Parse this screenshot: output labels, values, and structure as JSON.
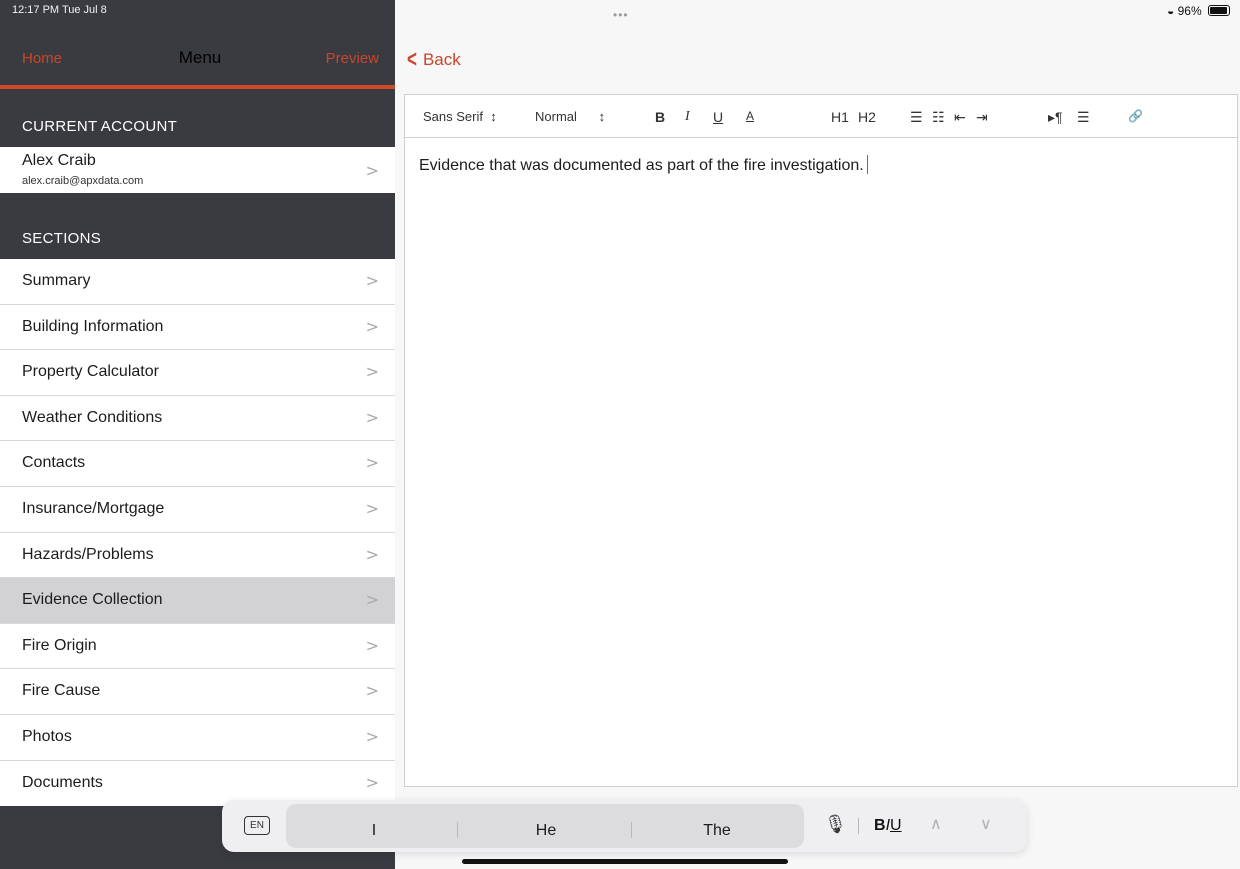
{
  "status_bar": {
    "time": "12:17 PM  Tue Jul 8",
    "dots": "•••",
    "battery": "96%"
  },
  "sidebar": {
    "nav": {
      "home": "Home",
      "title": "Menu",
      "preview": "Preview"
    },
    "account_header": "CURRENT ACCOUNT",
    "account": {
      "name": "Alex Craib",
      "email": "alex.craib@apxdata.com"
    },
    "sections_header": "SECTIONS",
    "items": [
      {
        "label": "Summary"
      },
      {
        "label": "Building Information"
      },
      {
        "label": "Property Calculator"
      },
      {
        "label": "Weather Conditions"
      },
      {
        "label": "Contacts"
      },
      {
        "label": "Insurance/Mortgage"
      },
      {
        "label": "Hazards/Problems"
      },
      {
        "label": "Evidence Collection",
        "selected": true
      },
      {
        "label": "Fire Origin"
      },
      {
        "label": "Fire Cause"
      },
      {
        "label": "Photos"
      },
      {
        "label": "Documents"
      }
    ],
    "chevron": ">"
  },
  "main": {
    "back_label": "Back",
    "toolbar": {
      "font": "Sans Serif",
      "size": "Normal",
      "bold": "B",
      "italic": "I",
      "underline": "U",
      "color": "A",
      "h1": "H1",
      "h2": "H2",
      "ordered_list": "☰",
      "bullet_list": "☷",
      "outdent": "⇤",
      "indent": "⇥",
      "direction": "▸¶",
      "align": "☰",
      "link": "🔗"
    },
    "content": "Evidence that was documented as part of the fire investigation."
  },
  "keyboard_bar": {
    "lang": "EN",
    "suggestions": [
      "I",
      "He",
      "The"
    ],
    "format": "BIU",
    "icons": [
      "mic-icon",
      "chevron-up-icon",
      "chevron-down-icon"
    ]
  },
  "colors": {
    "accent": "#c8462c",
    "sidebar_bg": "#3a3b40",
    "selected_row": "#d1d1d6"
  }
}
